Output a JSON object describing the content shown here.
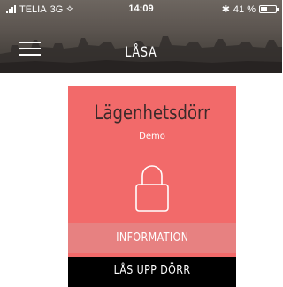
{
  "status_bar": {
    "carrier": "TELIA",
    "network": "3G",
    "time": "14:09",
    "battery_text": "41 %",
    "battery_level": 0.41
  },
  "header": {
    "title": "LÅSA",
    "menu_icon": "hamburger-menu-icon"
  },
  "lock_card": {
    "door_name": "Lägenhetsdörr",
    "subtitle": "Demo",
    "lock_icon": "padlock-icon",
    "info_label": "INFORMATION",
    "unlock_label": "LÅS UPP DÖRR",
    "colors": {
      "card": "#f26a6a",
      "info_bar": "#e78181",
      "unlock_bar": "#000000"
    }
  }
}
